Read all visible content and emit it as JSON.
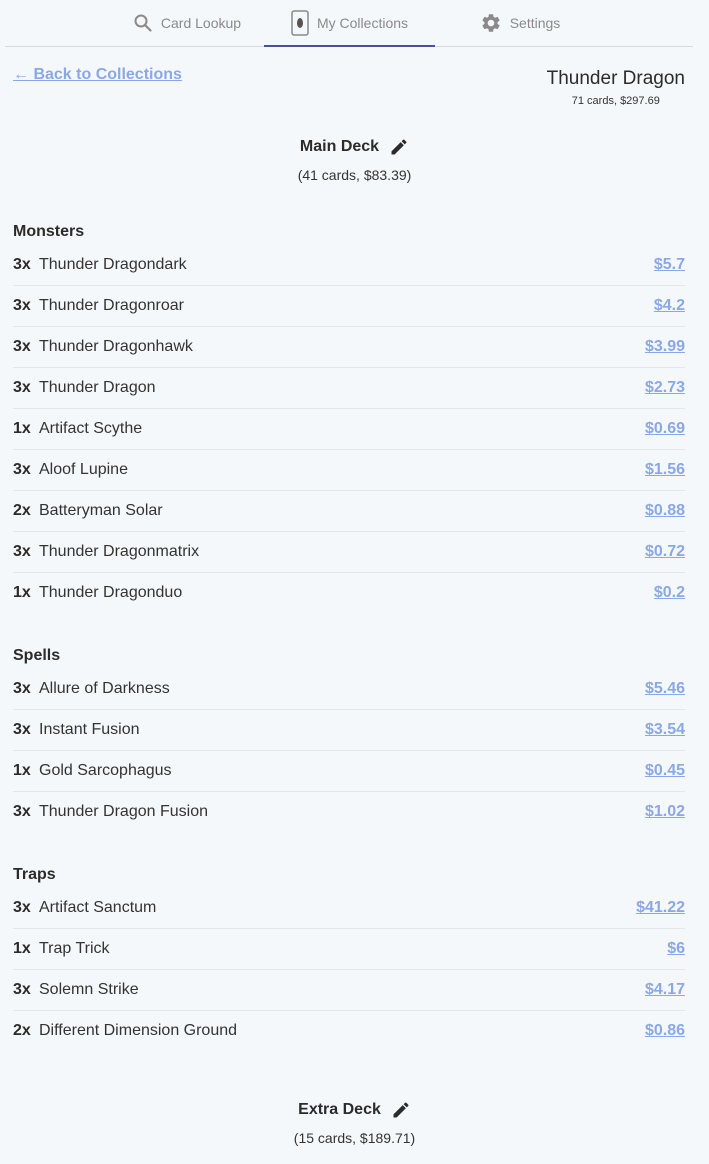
{
  "nav": {
    "tabs": [
      {
        "label": "Card Lookup",
        "icon": "search-icon"
      },
      {
        "label": "My Collections",
        "icon": "card-icon"
      },
      {
        "label": "Settings",
        "icon": "gear-icon"
      }
    ],
    "active_tab": "My Collections"
  },
  "header": {
    "back_label": "← Back to Collections",
    "deck_name": "Thunder Dragon",
    "deck_summary": "71 cards, $297.69"
  },
  "main_deck": {
    "title": "Main Deck",
    "summary": "(41 cards, $83.39)",
    "groups": [
      {
        "title": "Monsters",
        "cards": [
          {
            "qty": "3x",
            "name": "Thunder Dragondark",
            "price": "$5.7"
          },
          {
            "qty": "3x",
            "name": "Thunder Dragonroar",
            "price": "$4.2"
          },
          {
            "qty": "3x",
            "name": "Thunder Dragonhawk",
            "price": "$3.99"
          },
          {
            "qty": "3x",
            "name": "Thunder Dragon",
            "price": "$2.73"
          },
          {
            "qty": "1x",
            "name": "Artifact Scythe",
            "price": "$0.69"
          },
          {
            "qty": "3x",
            "name": "Aloof Lupine",
            "price": "$1.56"
          },
          {
            "qty": "2x",
            "name": "Batteryman Solar",
            "price": "$0.88"
          },
          {
            "qty": "3x",
            "name": "Thunder Dragonmatrix",
            "price": "$0.72"
          },
          {
            "qty": "1x",
            "name": "Thunder Dragonduo",
            "price": "$0.2"
          }
        ]
      },
      {
        "title": "Spells",
        "cards": [
          {
            "qty": "3x",
            "name": "Allure of Darkness",
            "price": "$5.46"
          },
          {
            "qty": "3x",
            "name": "Instant Fusion",
            "price": "$3.54"
          },
          {
            "qty": "1x",
            "name": "Gold Sarcophagus",
            "price": "$0.45"
          },
          {
            "qty": "3x",
            "name": "Thunder Dragon Fusion",
            "price": "$1.02"
          }
        ]
      },
      {
        "title": "Traps",
        "cards": [
          {
            "qty": "3x",
            "name": "Artifact Sanctum",
            "price": "$41.22"
          },
          {
            "qty": "1x",
            "name": "Trap Trick",
            "price": "$6"
          },
          {
            "qty": "3x",
            "name": "Solemn Strike",
            "price": "$4.17"
          },
          {
            "qty": "2x",
            "name": "Different Dimension Ground",
            "price": "$0.86"
          }
        ]
      }
    ]
  },
  "extra_deck": {
    "title": "Extra Deck",
    "summary": "(15 cards, $189.71)"
  },
  "colors": {
    "background": "#f5f8fb",
    "link": "#8aa8e6",
    "active_tab_underline": "#4a4f9e"
  }
}
